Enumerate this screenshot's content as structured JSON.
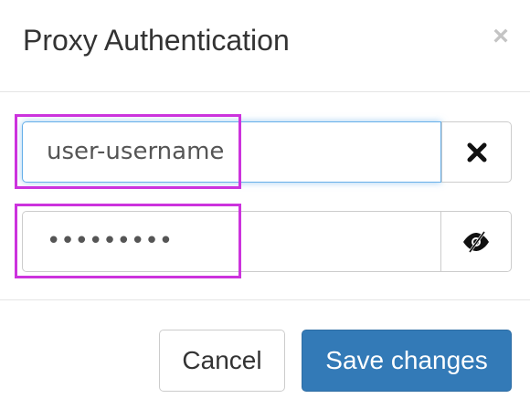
{
  "dialog": {
    "title": "Proxy Authentication",
    "close_symbol": "×"
  },
  "username": {
    "value": "user-username",
    "clear_icon": "close-x-icon"
  },
  "password": {
    "masked_value": "•••••••••",
    "toggle_icon": "eye-visibility-icon"
  },
  "footer": {
    "cancel_label": "Cancel",
    "save_label": "Save changes"
  },
  "colors": {
    "primary": "#337ab7",
    "focus_border": "#66afe9",
    "highlight": "#cc33dd"
  }
}
